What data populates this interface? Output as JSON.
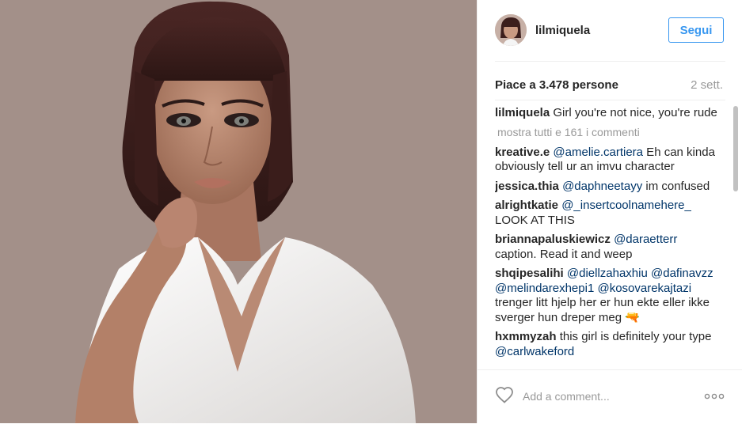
{
  "post": {
    "username": "lilmiquela",
    "follow_label": "Segui",
    "likes_text": "Piace a 3.478 persone",
    "time_text": "2 sett.",
    "view_all_text": "mostra tutti e 161 i commenti",
    "caption": {
      "user": "lilmiquela",
      "text": "Girl you're not nice, you're rude"
    },
    "comments": [
      {
        "user": "kreative.e",
        "mention1": "@amelie.cartiera",
        "text": " Eh can kinda obviously tell ur an imvu character"
      },
      {
        "user": "jessica.thia",
        "mention1": "@daphneetayy",
        "text": " im confused"
      },
      {
        "user": "alrightkatie",
        "mention1": "@_insertcoolnamehere_",
        "text": " LOOK AT THIS"
      },
      {
        "user": "briannapaluskiewicz",
        "mention1": "@daraetterr",
        "text": " caption. Read it and weep"
      },
      {
        "user": "shqipesalihi",
        "mention1": "@diellzahaxhiu",
        "mention2": "@dafinavzz",
        "mention3": "@melindarexhepi1",
        "mention4": "@kosovarekajtazi",
        "text": " trenger litt hjelp her er hun ekte eller ikke sverger hun dreper meg 🔫"
      },
      {
        "user": "hxmmyzah",
        "text": " this girl is definitely your type",
        "mention1": "@carlwakeford"
      }
    ],
    "comment_placeholder": "Add a comment...",
    "icons": {
      "like": "heart-icon",
      "more": "more-options-icon"
    }
  },
  "colors": {
    "accent": "#3897f0",
    "mention": "#003569",
    "muted": "#999999",
    "photo_background": "#a39089"
  }
}
